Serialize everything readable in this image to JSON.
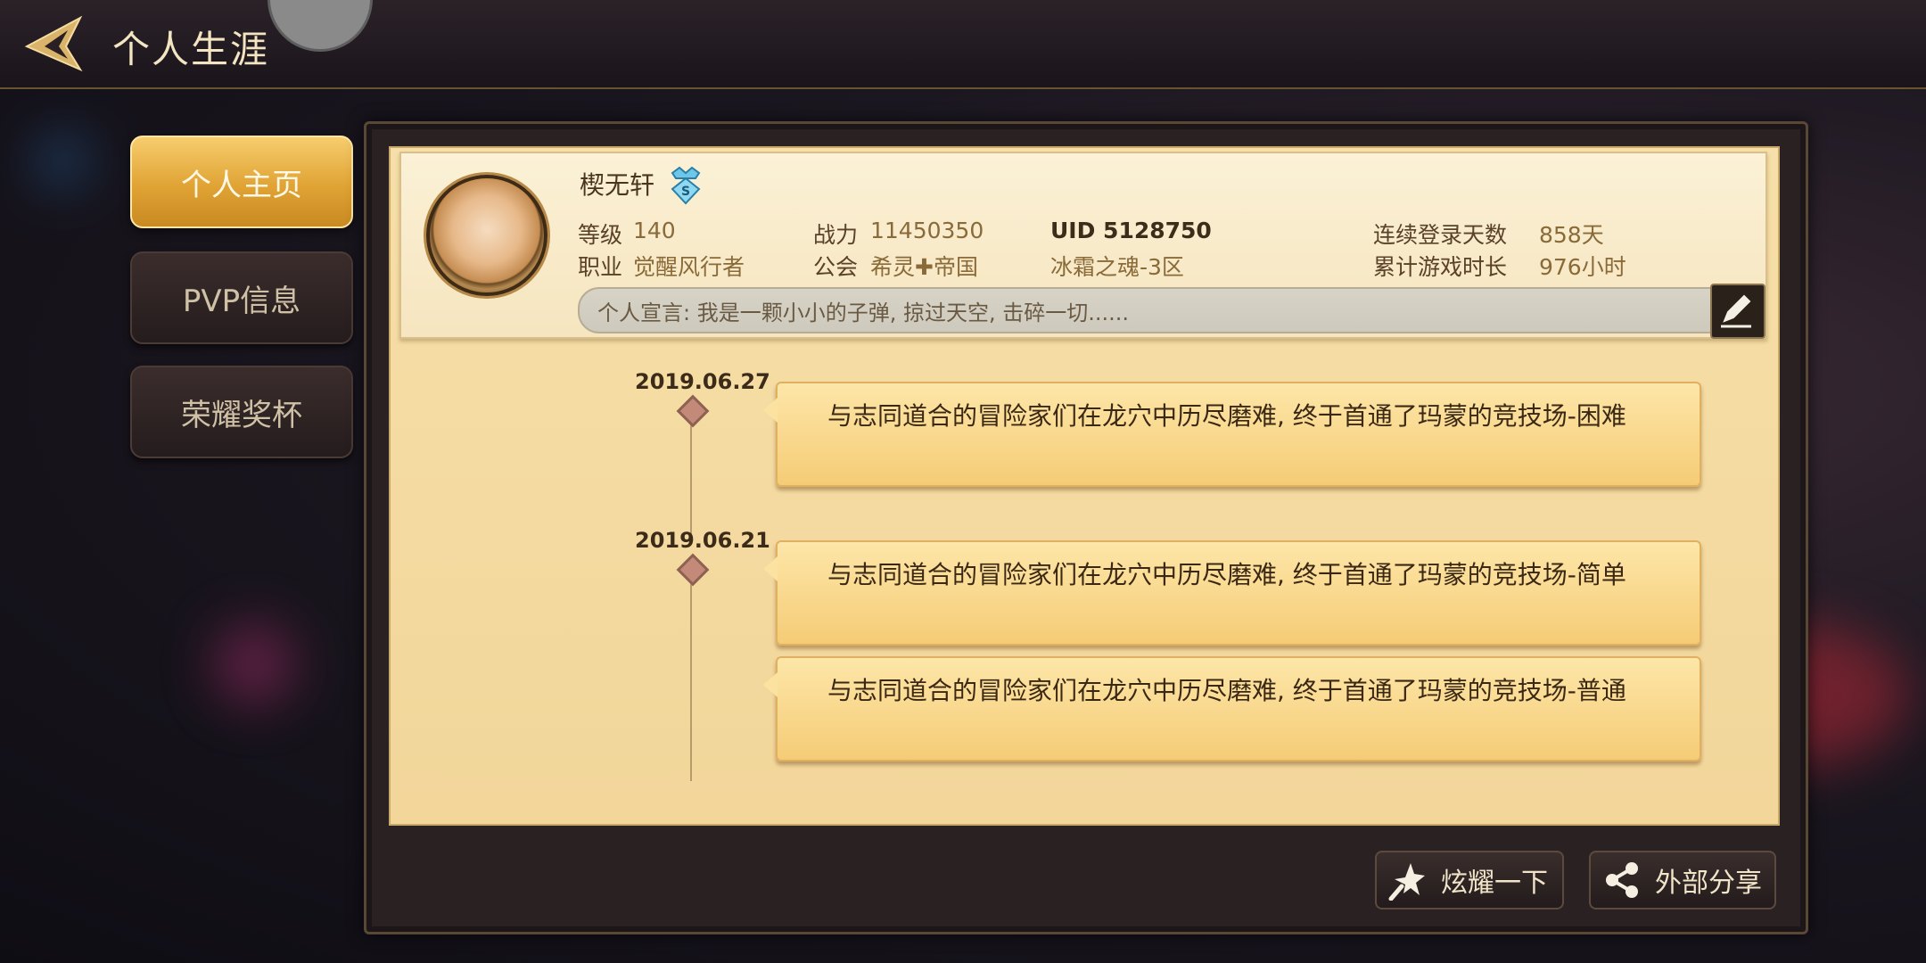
{
  "header": {
    "title": "个人生涯"
  },
  "tabs": [
    {
      "label": "个人主页",
      "active": true
    },
    {
      "label": "PVP信息",
      "active": false
    },
    {
      "label": "荣耀奖杯",
      "active": false
    }
  ],
  "profile": {
    "name": "楔无轩",
    "level_label": "等级",
    "level": "140",
    "power_label": "战力",
    "power": "11450350",
    "uid_text": "UID 5128750",
    "login_label": "连续登录天数",
    "login_days": "858天",
    "class_label": "职业",
    "class": "觉醒风行者",
    "guild_label": "公会",
    "guild": "希灵✚帝国",
    "server": "冰霜之魂-3区",
    "playtime_label": "累计游戏时长",
    "playtime": "976小时",
    "motto": "个人宣言: 我是一颗小小的子弹, 掠过天空, 击碎一切......"
  },
  "timeline": [
    {
      "date": "2019.06.27",
      "events": [
        "与志同道合的冒险家们在龙穴中历尽磨难, 终于首通了玛蒙的竞技场-困难"
      ]
    },
    {
      "date": "2019.06.21",
      "events": [
        "与志同道合的冒险家们在龙穴中历尽磨难, 终于首通了玛蒙的竞技场-简单",
        "与志同道合的冒险家们在龙穴中历尽磨难, 终于首通了玛蒙的竞技场-普通"
      ]
    }
  ],
  "actions": {
    "show_off": "炫耀一下",
    "share": "外部分享"
  },
  "colors": {
    "accent": "#e0a334",
    "card": "#f5cc76",
    "panel": "#f2d69a"
  }
}
